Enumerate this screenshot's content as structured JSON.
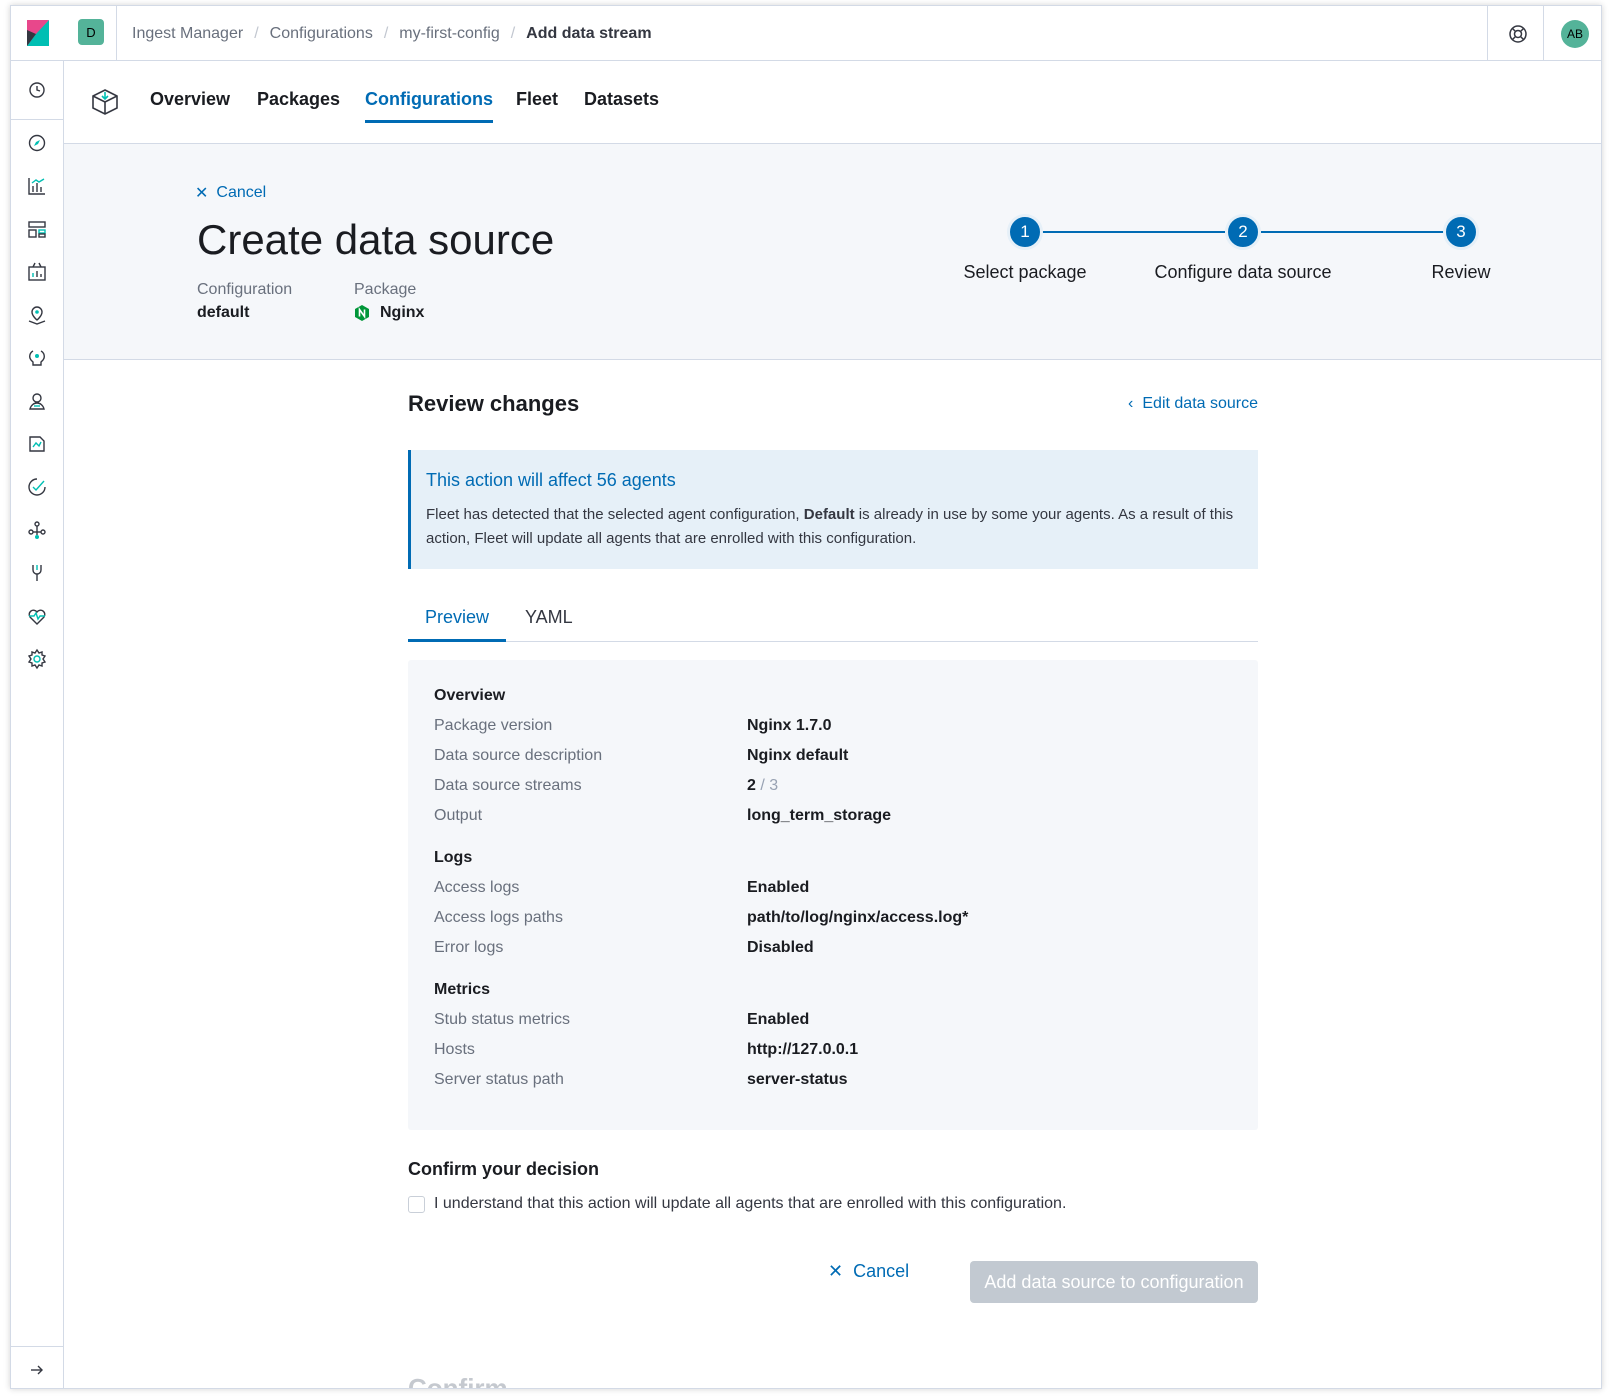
{
  "header": {
    "space_initial": "D",
    "breadcrumbs": [
      "Ingest Manager",
      "Configurations",
      "my-first-config",
      "Add data stream"
    ],
    "avatar_initials": "AB"
  },
  "colors": {
    "accent": "#006bb4",
    "space_badge": "#54b399",
    "avatar": "#54b399",
    "disabled_button": "#c2c9d1",
    "callout_bg": "#e6f0f8",
    "panel_bg": "#f5f7fa"
  },
  "sidenav": {
    "icons": [
      "clock-icon",
      "discover-icon",
      "visualize-icon",
      "dashboard-icon",
      "canvas-icon",
      "maps-icon",
      "ml-icon",
      "apm-icon",
      "uptime-icon",
      "siem-icon",
      "graph-icon",
      "dev-tools-icon",
      "monitoring-icon",
      "management-icon"
    ],
    "collapse_icon": "arrow-right-icon"
  },
  "app_tabs": [
    {
      "label": "Overview",
      "active": false
    },
    {
      "label": "Packages",
      "active": false
    },
    {
      "label": "Configurations",
      "active": true
    },
    {
      "label": "Fleet",
      "active": false
    },
    {
      "label": "Datasets",
      "active": false
    }
  ],
  "page_header": {
    "cancel_label": "Cancel",
    "title": "Create data source",
    "configuration_label": "Configuration",
    "configuration_value": "default",
    "package_label": "Package",
    "package_value": "Nginx"
  },
  "steps": [
    {
      "number": "1",
      "label": "Select package"
    },
    {
      "number": "2",
      "label": "Configure data source"
    },
    {
      "number": "3",
      "label": "Review"
    }
  ],
  "review": {
    "title": "Review changes",
    "edit_link": "Edit data source",
    "callout_title": "This action will affect 56 agents",
    "callout_text_before": "Fleet has detected that the selected agent configuration,",
    "callout_text_bold": "Default",
    "callout_text_after": "is already in use by some your agents. As a result of this action, Fleet will update all agents that are enrolled with this configuration.",
    "tabs": [
      {
        "label": "Preview",
        "active": true
      },
      {
        "label": "YAML",
        "active": false
      }
    ]
  },
  "preview": {
    "overview_title": "Overview",
    "overview_rows": [
      {
        "label": "Package version",
        "value": "Nginx 1.7.0"
      },
      {
        "label": "Data source description",
        "value": "Nginx default"
      },
      {
        "label": "Data source streams",
        "value": "2",
        "suffix": "/ 3"
      },
      {
        "label": "Output",
        "value": "long_term_storage"
      }
    ],
    "logs_title": "Logs",
    "logs_rows": [
      {
        "label": "Access logs",
        "value": "Enabled"
      },
      {
        "label": "Access logs paths",
        "value": "path/to/log/nginx/access.log*"
      },
      {
        "label": "Error logs",
        "value": "Disabled"
      }
    ],
    "metrics_title": "Metrics",
    "metrics_rows": [
      {
        "label": "Stub status metrics",
        "value": "Enabled"
      },
      {
        "label": "Hosts",
        "value": "http://127.0.0.1"
      },
      {
        "label": "Server status path",
        "value": "server-status"
      }
    ]
  },
  "confirm": {
    "title": "Confirm your decision",
    "checkbox_label": "I understand that this action will update all agents that are enrolled with this configuration.",
    "checked": false
  },
  "actions": {
    "cancel_label": "Cancel",
    "submit_label": "Add data source to configuration"
  },
  "peek_text": "Confirm"
}
